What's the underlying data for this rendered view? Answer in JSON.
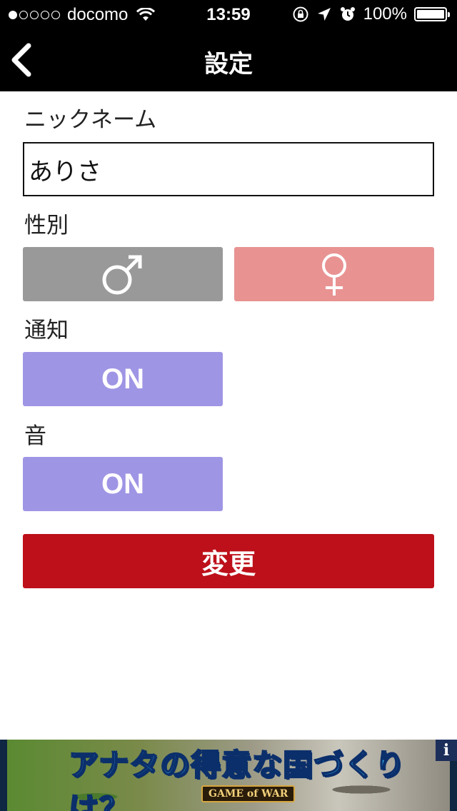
{
  "status_bar": {
    "carrier": "docomo",
    "time": "13:59",
    "battery": "100%"
  },
  "nav": {
    "title": "設定"
  },
  "form": {
    "nickname_label": "ニックネーム",
    "nickname_value": "ありさ",
    "gender_label": "性別",
    "notification_label": "通知",
    "notification_value": "ON",
    "sound_label": "音",
    "sound_value": "ON",
    "submit_label": "変更"
  },
  "ad": {
    "headline": "アナタの得意な国づくりは？",
    "logo": "GAME of WAR",
    "info": "i"
  },
  "colors": {
    "male": "#999999",
    "female": "#e89392",
    "toggle_on": "#9f95e5",
    "submit": "#bd101a"
  }
}
